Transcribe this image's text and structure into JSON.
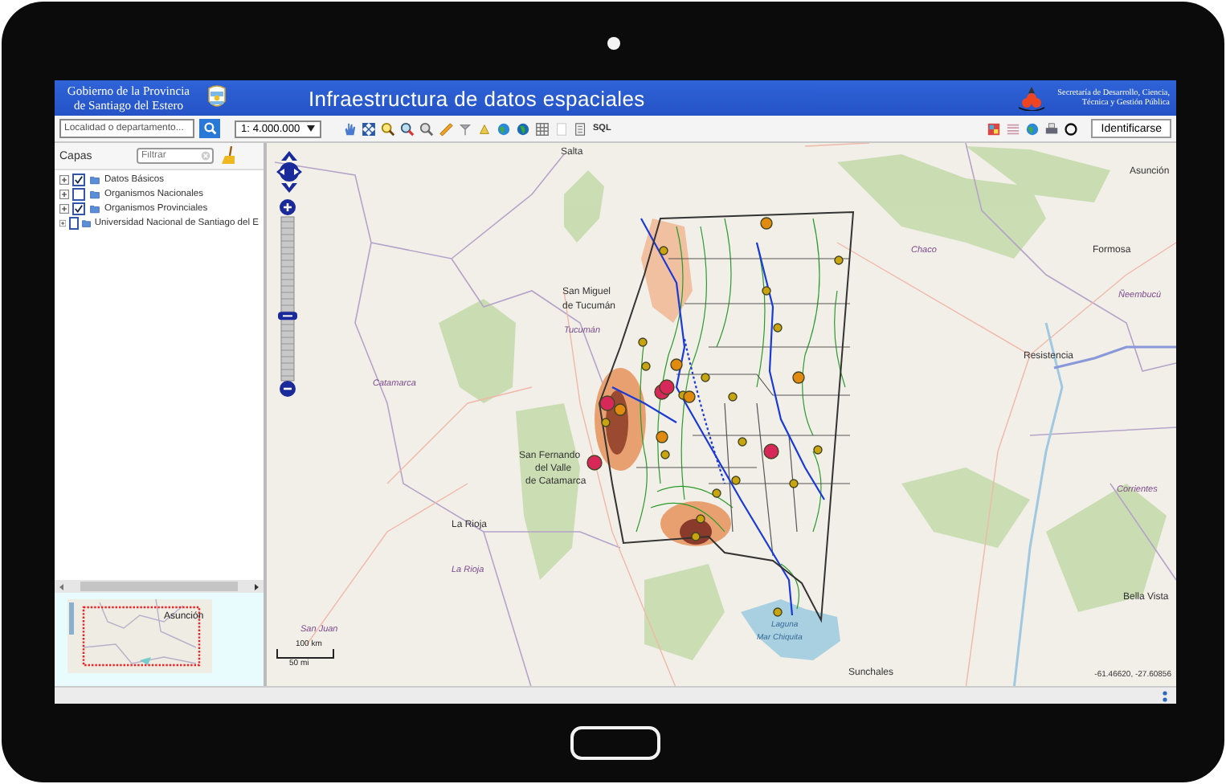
{
  "header": {
    "agency_lines": [
      "Gobierno de la Provincia",
      "de Santiago del Estero"
    ],
    "title": "Infraestructura de datos espaciales",
    "secretariat_lines": [
      "Secretaría de Desarrollo, Ciencia,",
      "Técnica y Gestión Pública"
    ]
  },
  "toolbar": {
    "search_placeholder": "Localidad o departamento...",
    "scale": "1: 4.000.000",
    "sql_label": "SQL",
    "login_button": "Identificarse"
  },
  "layers_panel": {
    "title": "Capas",
    "filter_placeholder": "Filtrar",
    "layers": [
      {
        "label": "Datos Básicos",
        "checked": true
      },
      {
        "label": "Organismos Nacionales",
        "checked": false
      },
      {
        "label": "Organismos Provinciales",
        "checked": true
      },
      {
        "label": "Universidad Nacional de Santiago del E",
        "checked": false
      }
    ]
  },
  "overview_map": {
    "label": "Asunción"
  },
  "zoom_slider": {
    "level": 0.39
  },
  "map": {
    "labels": [
      {
        "text": "Salta",
        "kind": "city"
      },
      {
        "text": "San Miguel",
        "kind": "city"
      },
      {
        "text": "de Tucumán",
        "kind": "city"
      },
      {
        "text": "Tucumán",
        "kind": "province"
      },
      {
        "text": "Catamarca",
        "kind": "province"
      },
      {
        "text": "San Fernando",
        "kind": "city"
      },
      {
        "text": "del Valle",
        "kind": "city"
      },
      {
        "text": "de Catamarca",
        "kind": "city"
      },
      {
        "text": "La Rioja",
        "kind": "city"
      },
      {
        "text": "La Rioja",
        "kind": "province"
      },
      {
        "text": "San Juan",
        "kind": "province"
      },
      {
        "text": "Chaco",
        "kind": "province"
      },
      {
        "text": "Formosa",
        "kind": "city"
      },
      {
        "text": "Asunción",
        "kind": "city"
      },
      {
        "text": "Resistencia",
        "kind": "city"
      },
      {
        "text": "Ñeembucú",
        "kind": "province"
      },
      {
        "text": "Corrientes",
        "kind": "province"
      },
      {
        "text": "Bella Vista",
        "kind": "city"
      },
      {
        "text": "Sunchales",
        "kind": "city"
      },
      {
        "text": "Laguna",
        "kind": "water"
      },
      {
        "text": "Mar Chiquita",
        "kind": "water"
      }
    ],
    "scale_km": "100 km",
    "scale_mi": "50 mi",
    "coordinates": "-61.46620, -27.60856"
  }
}
